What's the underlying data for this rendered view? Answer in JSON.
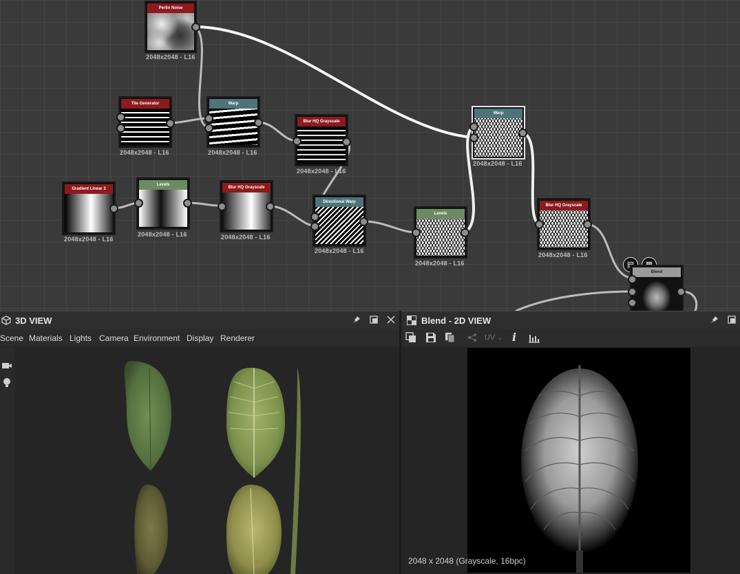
{
  "graph": {
    "nodes": [
      {
        "id": "perlin",
        "title": "Perlin Noise",
        "res": "2048x2048 - L16"
      },
      {
        "id": "tile",
        "title": "Tile Generator",
        "res": "2048x2048 - L16"
      },
      {
        "id": "warp1",
        "title": "Warp",
        "res": "2048x2048 - L16"
      },
      {
        "id": "blur1",
        "title": "Blur HQ Grayscale",
        "res": "2048x2048 - L16"
      },
      {
        "id": "warp2",
        "title": "Warp",
        "res": "2048x2048 - L16"
      },
      {
        "id": "gradient",
        "title": "Gradient Linear 3",
        "res": "2048x2048 - L16"
      },
      {
        "id": "levels1",
        "title": "Levels",
        "res": "2048x2048 - L16"
      },
      {
        "id": "blur2",
        "title": "Blur HQ Grayscale",
        "res": "2048x2048 - L16"
      },
      {
        "id": "dirwarp",
        "title": "Directional Warp",
        "res": "2048x2048 - L16"
      },
      {
        "id": "levels2",
        "title": "Levels",
        "res": "2048x2048 - L16"
      },
      {
        "id": "blur3",
        "title": "Blur HQ Grayscale",
        "res": "2048x2048 - L16"
      },
      {
        "id": "blend",
        "title": "Blend",
        "res": ""
      }
    ]
  },
  "view3d": {
    "title": "3D VIEW",
    "menu": [
      "Scene",
      "Materials",
      "Lights",
      "Camera",
      "Environment",
      "Display",
      "Renderer"
    ]
  },
  "view2d": {
    "title": "Blend - 2D VIEW",
    "uv_label": "UV",
    "status": "2048 x 2048 (Grayscale, 16bpc)"
  },
  "colors": {
    "header_red": "#8d1a1d",
    "header_teal": "#4e7477",
    "header_green": "#6a8c62",
    "graph_bg": "#3a3a3a",
    "panel_bg": "#252525"
  }
}
